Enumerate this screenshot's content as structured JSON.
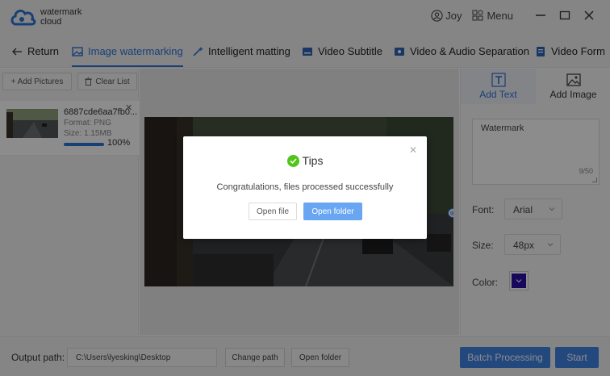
{
  "app": {
    "logo_line1": "watermark",
    "logo_line2": "cloud",
    "accent": "#2f73d9"
  },
  "window": {
    "user": "Joy",
    "menu": "Menu"
  },
  "nav": {
    "return": "Return",
    "tabs": [
      "Image watermarking",
      "Intelligent matting",
      "Video Subtitle",
      "Video & Audio Separation",
      "Video Form"
    ]
  },
  "left": {
    "add_pictures": "+ Add Pictures",
    "clear_list": "Clear List",
    "file": {
      "name": "6887cde6aa7fb0...",
      "format": "Format:  PNG",
      "size": "Size:  1.15MB",
      "progress_text": "100%",
      "progress": 1.0
    }
  },
  "right": {
    "tabs": [
      "Add Text",
      "Add Image"
    ],
    "watermark_text": "Watermark",
    "char_count": "9/50",
    "font_label": "Font:",
    "font_value": "Arial",
    "size_label": "Size:",
    "size_value": "48px",
    "color_label": "Color:",
    "color_value": "#2a0fa8"
  },
  "bottom": {
    "output_label": "Output path:",
    "output_path": "C:\\Users\\lyesking\\Desktop",
    "change_path": "Change path",
    "open_folder": "Open folder",
    "batch": "Batch Processing",
    "start": "Start"
  },
  "modal": {
    "title": "Tips",
    "message": "Congratulations, files processed successfully",
    "open_file": "Open file",
    "open_folder": "Open folder"
  }
}
